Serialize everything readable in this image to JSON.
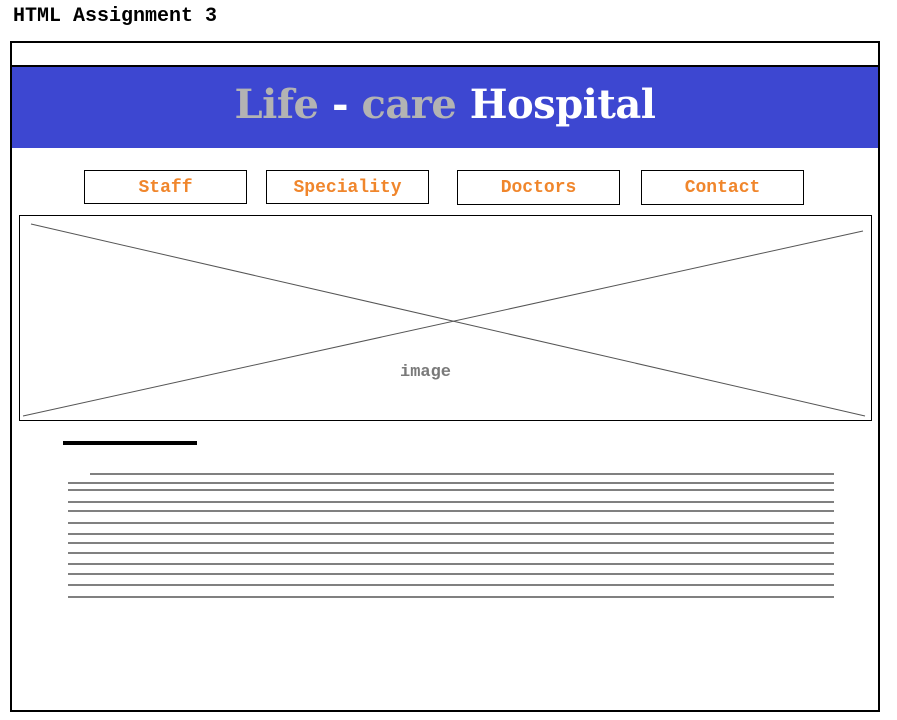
{
  "page": {
    "title": "HTML Assignment 3"
  },
  "banner": {
    "title_part1": "Life",
    "title_sep": " - ",
    "title_part2": "care",
    "title_part3": "Hospital",
    "background_color": "#3d47d1",
    "grey_text_color": "#b3b3b3",
    "white_text_color": "#ffffff"
  },
  "nav": {
    "text_color": "#f0862c",
    "items": [
      {
        "label": "Staff"
      },
      {
        "label": "Speciality"
      },
      {
        "label": "Doctors"
      },
      {
        "label": "Contact"
      }
    ]
  },
  "hero_image": {
    "label": "image",
    "placeholder_icon": "image-placeholder-cross-icon"
  }
}
